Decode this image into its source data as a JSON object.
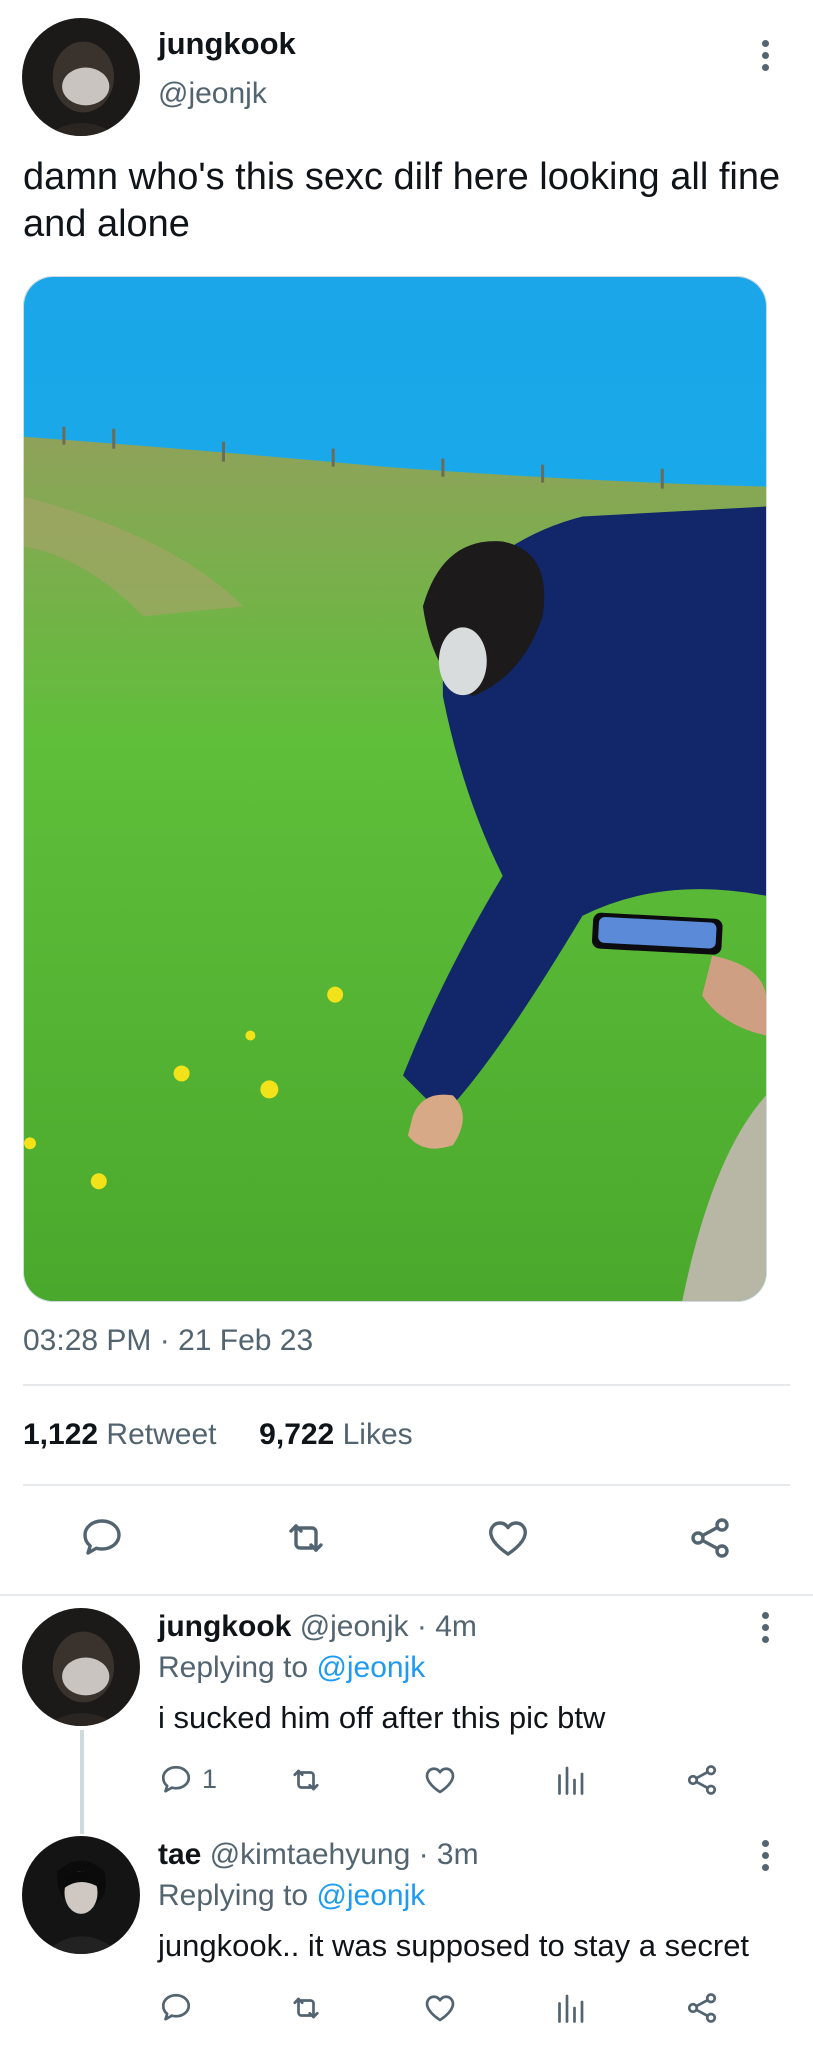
{
  "tweet": {
    "author_name": "jungkook",
    "author_handle": "@jeonjk",
    "text": "damn who's this sexc dilf here looking all fine and alone",
    "timestamp": "03:28 PM · 21 Feb 23",
    "retweet_count": "1,122",
    "retweet_label": "Retweet",
    "like_count": "9,722",
    "like_label": "Likes",
    "icons": [
      "reply-icon",
      "retweet-icon",
      "like-icon",
      "share-icon",
      "more-icon"
    ]
  },
  "replies": [
    {
      "author_name": "jungkook",
      "author_handle": "@jeonjk",
      "time": "· 4m",
      "replying_prefix": "Replying to",
      "replying_to": "@jeonjk",
      "text": "i sucked him off after this pic btw",
      "reply_count": "1"
    },
    {
      "author_name": "tae",
      "author_handle": "@kimtaehyung",
      "time": "· 3m",
      "replying_prefix": "Replying to",
      "replying_to": "@jeonjk",
      "text": "jungkook.. it was supposed to stay a secret",
      "reply_count": ""
    }
  ],
  "colors": {
    "link": "#1d9bf0",
    "secondary_text": "#536471",
    "primary_text": "#0f1419",
    "divider": "#e6e9ec"
  }
}
